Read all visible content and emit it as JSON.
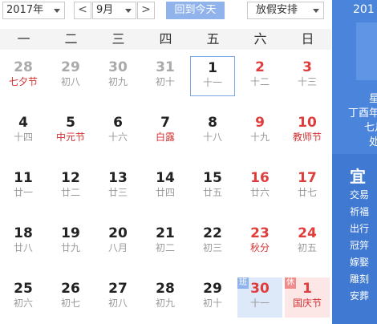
{
  "toolbar": {
    "year_select": "2017年",
    "prev_month": "<",
    "month_select": "9月",
    "next_month": ">",
    "today_button": "回到今天",
    "holiday_select": "放假安排"
  },
  "weekdays": [
    "一",
    "二",
    "三",
    "四",
    "五",
    "六",
    "日"
  ],
  "tags": {
    "work": "班",
    "rest": "休"
  },
  "weeks": [
    [
      {
        "num": "28",
        "lunar": "七夕节",
        "other": true,
        "fest": true
      },
      {
        "num": "29",
        "lunar": "初八",
        "other": true
      },
      {
        "num": "30",
        "lunar": "初九",
        "other": true
      },
      {
        "num": "31",
        "lunar": "初十",
        "other": true
      },
      {
        "num": "1",
        "lunar": "十一",
        "selected": true
      },
      {
        "num": "2",
        "lunar": "十二",
        "weekend": true
      },
      {
        "num": "3",
        "lunar": "十三",
        "weekend": true
      }
    ],
    [
      {
        "num": "4",
        "lunar": "十四"
      },
      {
        "num": "5",
        "lunar": "中元节",
        "fest": true
      },
      {
        "num": "6",
        "lunar": "十六"
      },
      {
        "num": "7",
        "lunar": "白露",
        "fest": true
      },
      {
        "num": "8",
        "lunar": "十八"
      },
      {
        "num": "9",
        "lunar": "十九",
        "weekend": true
      },
      {
        "num": "10",
        "lunar": "教师节",
        "weekend": true,
        "fest": true
      }
    ],
    [
      {
        "num": "11",
        "lunar": "廿一"
      },
      {
        "num": "12",
        "lunar": "廿二"
      },
      {
        "num": "13",
        "lunar": "廿三"
      },
      {
        "num": "14",
        "lunar": "廿四"
      },
      {
        "num": "15",
        "lunar": "廿五"
      },
      {
        "num": "16",
        "lunar": "廿六",
        "weekend": true
      },
      {
        "num": "17",
        "lunar": "廿七",
        "weekend": true
      }
    ],
    [
      {
        "num": "18",
        "lunar": "廿八"
      },
      {
        "num": "19",
        "lunar": "廿九"
      },
      {
        "num": "20",
        "lunar": "八月"
      },
      {
        "num": "21",
        "lunar": "初二"
      },
      {
        "num": "22",
        "lunar": "初三"
      },
      {
        "num": "23",
        "lunar": "秋分",
        "weekend": true,
        "fest": true
      },
      {
        "num": "24",
        "lunar": "初五",
        "weekend": true
      }
    ],
    [
      {
        "num": "25",
        "lunar": "初六"
      },
      {
        "num": "26",
        "lunar": "初七"
      },
      {
        "num": "27",
        "lunar": "初八"
      },
      {
        "num": "28",
        "lunar": "初九"
      },
      {
        "num": "29",
        "lunar": "初十"
      },
      {
        "num": "30",
        "lunar": "十一",
        "weekend": true,
        "work": true
      },
      {
        "num": "1",
        "lunar": "国庆节",
        "weekend": true,
        "fest": true,
        "rest": true,
        "other": true
      }
    ]
  ],
  "side": {
    "year": "201",
    "lines": [
      "星",
      "丁酉年",
      "七月",
      "处"
    ],
    "yi": "宜",
    "yi_items": [
      "交易",
      "祈福",
      "出行",
      "冠笄",
      "嫁娶",
      "雕刻",
      "安葬"
    ]
  }
}
